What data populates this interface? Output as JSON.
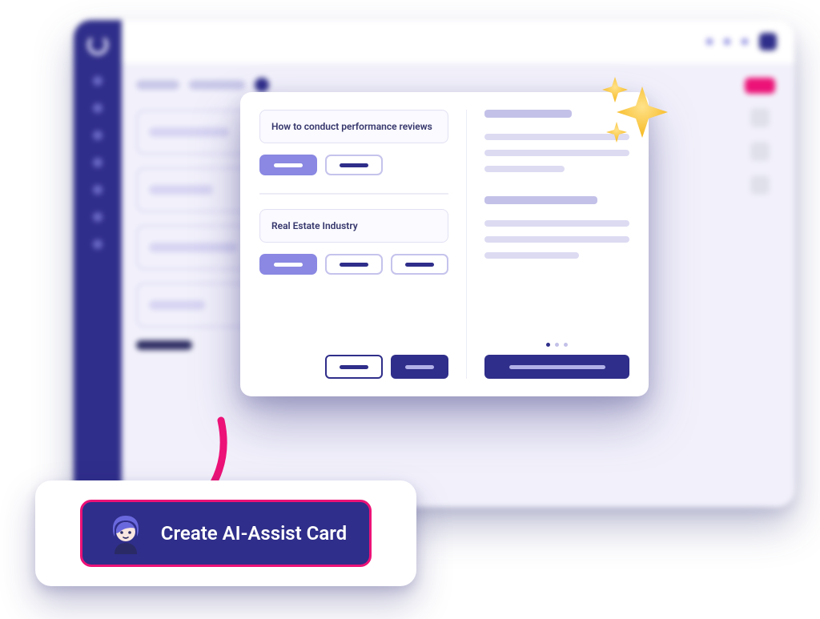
{
  "modal": {
    "field1": "How to conduct performance reviews",
    "field2": "Real Estate Industry"
  },
  "cta": {
    "label": "Create AI-Assist Card"
  }
}
